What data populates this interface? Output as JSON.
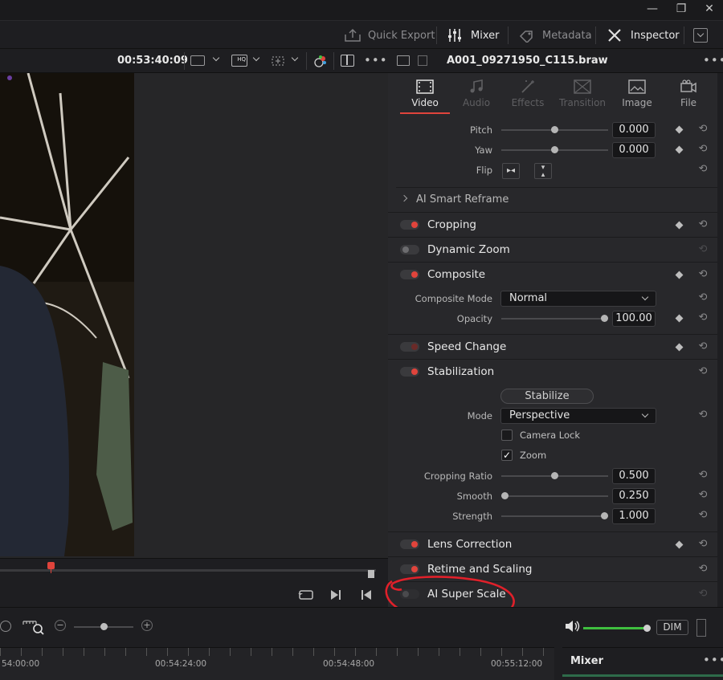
{
  "window": {
    "min_icon": "minimize-icon",
    "max_icon": "restore-icon",
    "close_icon": "close-icon",
    "min_glyph": "—",
    "max_glyph": "❐",
    "close_glyph": "✕"
  },
  "toolbar": {
    "quick_export": "Quick Export",
    "mixer": "Mixer",
    "metadata": "Metadata",
    "inspector": "Inspector"
  },
  "viewer": {
    "timecode": "00:53:40:09"
  },
  "inspector": {
    "clip_name": "A001_09271950_C115.braw",
    "tabs": [
      {
        "label": "Video",
        "active": true
      },
      {
        "label": "Audio",
        "active": false
      },
      {
        "label": "Effects",
        "active": false
      },
      {
        "label": "Transition",
        "active": false
      },
      {
        "label": "Image",
        "active": false
      },
      {
        "label": "File",
        "active": false
      }
    ],
    "transform": {
      "pitch_label": "Pitch",
      "pitch_value": "0.000",
      "yaw_label": "Yaw",
      "yaw_value": "0.000",
      "flip_label": "Flip"
    },
    "smart_reframe": "AI Smart Reframe",
    "sections": {
      "cropping": "Cropping",
      "dynamic_zoom": "Dynamic Zoom",
      "composite": "Composite",
      "speed_change": "Speed Change",
      "stabilization": "Stabilization",
      "lens_correction": "Lens Correction",
      "retime_scaling": "Retime and Scaling",
      "ai_super_scale": "AI Super Scale"
    },
    "composite": {
      "mode_label": "Composite Mode",
      "mode_value": "Normal",
      "opacity_label": "Opacity",
      "opacity_value": "100.00",
      "opacity": 1.0
    },
    "stabilization": {
      "stabilize_button": "Stabilize",
      "mode_label": "Mode",
      "mode_value": "Perspective",
      "camera_lock": "Camera Lock",
      "camera_lock_checked": false,
      "zoom": "Zoom",
      "zoom_checked": true,
      "cropping_ratio_label": "Cropping Ratio",
      "cropping_ratio_value": "0.500",
      "cropping_ratio": 0.5,
      "smooth_label": "Smooth",
      "smooth_value": "0.250",
      "smooth": 0.0,
      "strength_label": "Strength",
      "strength_value": "1.000",
      "strength": 1.0
    }
  },
  "bottom": {
    "dim": "DIM"
  },
  "timeline": {
    "ticks": [
      "54:00:00",
      "00:54:24:00",
      "00:54:48:00",
      "00:55:12:00"
    ]
  },
  "mixer_panel": {
    "title": "Mixer"
  },
  "colors": {
    "accent": "#e0443c",
    "annotation": "#e0202a",
    "meter": "#3fbf3f"
  }
}
